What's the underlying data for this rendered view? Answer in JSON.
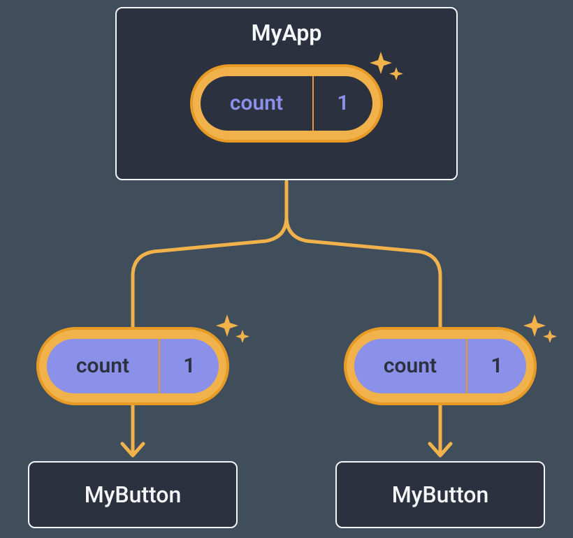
{
  "colors": {
    "bg": "#404e5c",
    "panel": "#2c313f",
    "panel_border": "#f5f6f7",
    "accent": "#e79b25",
    "accent_light": "#f2b24b",
    "purple": "#8b91e8",
    "text_light": "#f5f6f7"
  },
  "parent": {
    "title": "MyApp",
    "state_label": "count",
    "state_value": "1"
  },
  "children": [
    {
      "prop_label": "count",
      "prop_value": "1",
      "title": "MyButton"
    },
    {
      "prop_label": "count",
      "prop_value": "1",
      "title": "MyButton"
    }
  ]
}
